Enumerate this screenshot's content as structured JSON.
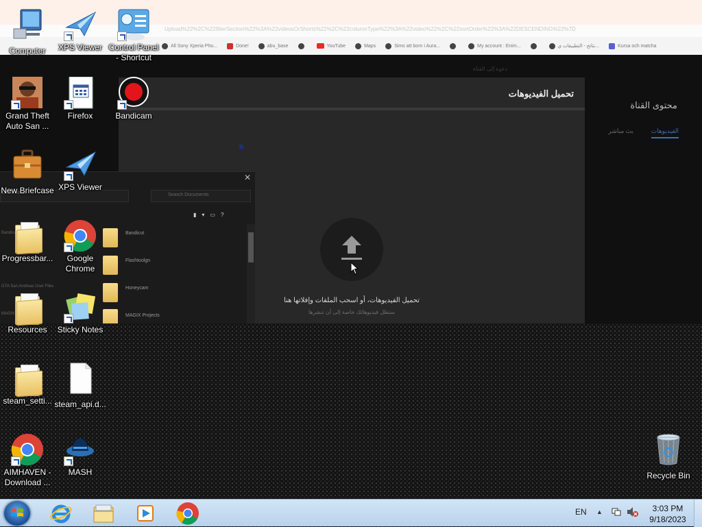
{
  "browser": {
    "url": "Upload%22%2C%22filterSection%22%3A%22videosOrShorts%22%2C%22columnType%22%3A%22video%22%2C%22sortOrder%22%3A%22DESCENDING%22%7D",
    "bookmarks": [
      {
        "label": "All Sony Xperia Pho...",
        "icon": "xperia-icon"
      },
      {
        "label": "Done!",
        "icon": "red-icon"
      },
      {
        "label": "abu_base",
        "icon": "globe-icon"
      },
      {
        "label": "",
        "icon": "globe-icon"
      },
      {
        "label": "YouTube",
        "icon": "youtube-icon"
      },
      {
        "label": "Maps",
        "icon": "maps-icon"
      },
      {
        "label": "Sims att born i Aura...",
        "icon": "globe-icon"
      },
      {
        "label": "",
        "icon": "globe-icon"
      },
      {
        "label": "My account : Enim...",
        "icon": "globe-icon"
      },
      {
        "label": "",
        "icon": "globe-icon"
      },
      {
        "label": "نتائج - التطبيقات ي...",
        "icon": "globe-icon"
      },
      {
        "label": "Kursa och matcha",
        "icon": "purple-icon"
      }
    ],
    "top_label": "دعوة إلى القناة",
    "side_title": "محتوى القناة",
    "side_tab_active": "الفيديوهات",
    "side_tab_2": "بث مباشر",
    "dialog_title": "تحميل الفيديوهات",
    "dialog_text": "تحميل الفيديوهات، أو اسحب الملفات وإفلاتها هنا",
    "dialog_subtext": "ستظل فيديوهاتك خاصة إلى أن تنشرها"
  },
  "explorer": {
    "address": "Documents",
    "search_placeholder": "Search Documents",
    "folders": [
      "Bandicut",
      "Flashtoolgn",
      "Honeycam",
      "MAGIX Projects"
    ],
    "left_items": [
      "Bandicam",
      "GTA San Andreas User Files",
      "MAGIX Downloads",
      "Movie Studio 15.0 Projects"
    ]
  },
  "desktop_icons": [
    {
      "label": "Computer",
      "icon": "computer-icon"
    },
    {
      "label": "XPS Viewer",
      "icon": "xps-viewer-icon"
    },
    {
      "label": "Control Panel - Shortcut",
      "icon": "control-panel-icon"
    },
    {
      "label": "Grand Theft Auto San ...",
      "icon": "gta-icon"
    },
    {
      "label": "Firefox",
      "icon": "firefox-icon"
    },
    {
      "label": "Bandicam",
      "icon": "bandicam-icon"
    },
    {
      "label": "New Briefcase",
      "icon": "briefcase-icon"
    },
    {
      "label": "XPS Viewer",
      "icon": "xps-viewer-icon"
    },
    {
      "label": "Progressbar...",
      "icon": "folder-icon"
    },
    {
      "label": "Google Chrome",
      "icon": "chrome-icon"
    },
    {
      "label": "Resources",
      "icon": "folder-icon"
    },
    {
      "label": "Sticky Notes",
      "icon": "sticky-notes-icon"
    },
    {
      "label": "steam_setti...",
      "icon": "folder-icon"
    },
    {
      "label": "steam_api.d...",
      "icon": "file-icon"
    },
    {
      "label": "AIMHAVEN - Download ...",
      "icon": "chrome-icon"
    },
    {
      "label": "MASH",
      "icon": "mash-icon"
    },
    {
      "label": "Recycle Bin",
      "icon": "recycle-bin-icon"
    }
  ],
  "taskbar": {
    "items": [
      "internet-explorer-icon",
      "file-explorer-icon",
      "media-player-icon",
      "chrome-icon"
    ],
    "language": "EN",
    "time": "3:03 PM",
    "date": "9/18/2023"
  },
  "colors": {
    "taskbar_top": "#d3e5f6",
    "taskbar_bottom": "#b9d2ec",
    "dialog_bg": "#282828",
    "youtube_blue": "#3f6fb8"
  }
}
